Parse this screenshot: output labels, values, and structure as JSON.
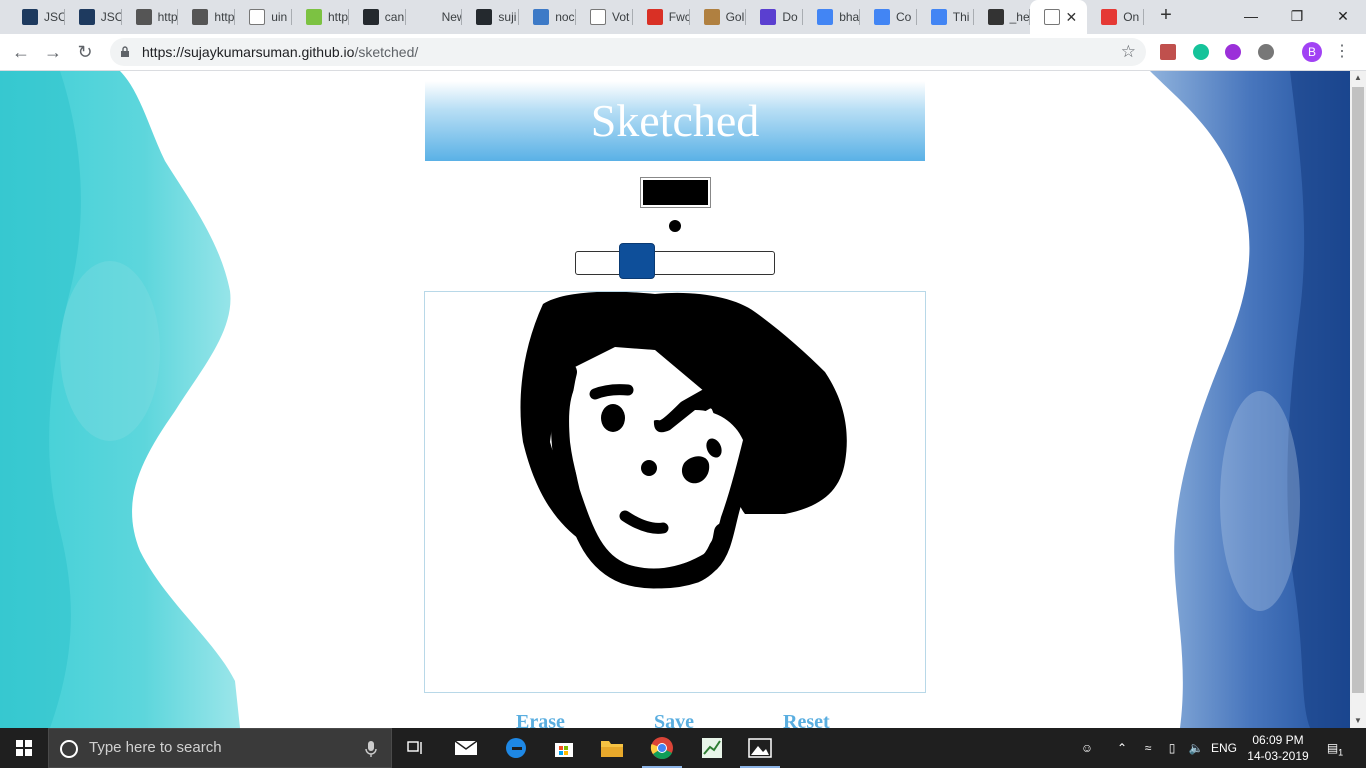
{
  "browser": {
    "tabs": [
      {
        "label": "JSC",
        "fav": "#1e3a5f"
      },
      {
        "label": "JSC",
        "fav": "#1e3a5f"
      },
      {
        "label": "http",
        "fav": "#555555"
      },
      {
        "label": "http",
        "fav": "#555555"
      },
      {
        "label": "uin",
        "fav": "#ffffff"
      },
      {
        "label": "http",
        "fav": "#7cc242"
      },
      {
        "label": "can",
        "fav": "#24292e"
      },
      {
        "label": "New Tal",
        "fav": ""
      },
      {
        "label": "suji",
        "fav": "#24292e"
      },
      {
        "label": "noc",
        "fav": "#3d7ac7"
      },
      {
        "label": "Vot",
        "fav": "#ffffff"
      },
      {
        "label": "Fwc",
        "fav": "#d93025"
      },
      {
        "label": "Gol",
        "fav": "#b08040"
      },
      {
        "label": "Do",
        "fav": "#5a3fd0"
      },
      {
        "label": "bha",
        "fav": "#4285f4"
      },
      {
        "label": "Co",
        "fav": "#4285f4"
      },
      {
        "label": "Thi",
        "fav": "#4285f4"
      },
      {
        "label": "_he",
        "fav": "#333333"
      },
      {
        "label": "",
        "fav": "#ffffff"
      },
      {
        "label": "On",
        "fav": "#e53935"
      }
    ],
    "url_host": "https://sujaykumarsuman.github.io",
    "url_path": "/sketched/",
    "avatar_letter": "B"
  },
  "app": {
    "title": "Sketched",
    "stroke_color": "#000000",
    "brush_size_fraction": 0.26,
    "actions": {
      "erase": "Erase",
      "save": "Save",
      "reset": "Reset"
    }
  },
  "taskbar": {
    "search_placeholder": "Type here to search",
    "language": "ENG",
    "time": "06:09 PM",
    "date": "14-03-2019",
    "notification_count": "1"
  }
}
